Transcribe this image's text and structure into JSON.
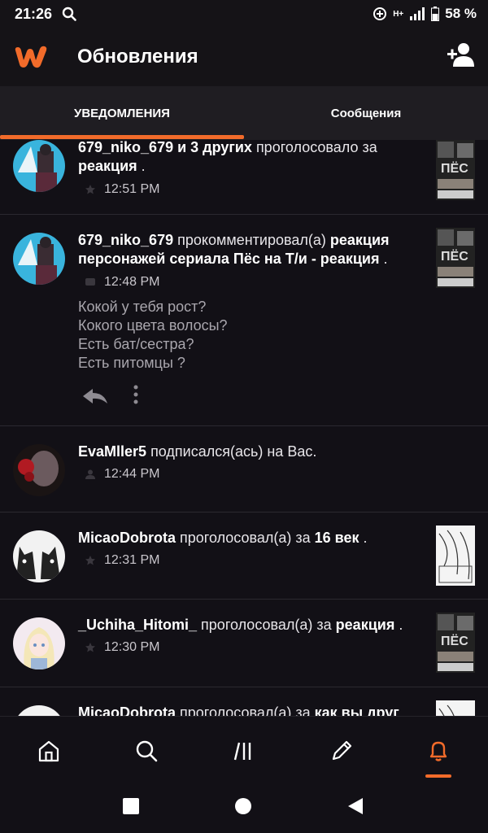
{
  "status_bar": {
    "time": "21:26",
    "network": "H+",
    "battery": "58 %"
  },
  "header": {
    "title": "Обновления"
  },
  "tabs": [
    {
      "label": "УВЕДОМЛЕНИЯ",
      "active": true
    },
    {
      "label": "Сообщения",
      "active": false
    }
  ],
  "notifications": [
    {
      "user": "679_niko_679 и 3 других",
      "action": " проголосовало за ",
      "target": "реакция",
      "suffix": " .",
      "time": "12:51 PM",
      "icon": "star-icon"
    },
    {
      "user": "679_niko_679",
      "action": " прокомментировал(а) ",
      "target": "реакция персонажей сериала Пёс на Т/и - реакция",
      "suffix": " .",
      "time": "12:48 PM",
      "icon": "comment-icon",
      "comment": [
        "Кокой у тебя рост?",
        "Кокого цвета волосы?",
        "Есть бат/сестра?",
        "Есть питомцы ?"
      ]
    },
    {
      "user": "EvaMller5",
      "action": " подписался(ась) на Вас.",
      "target": "",
      "suffix": "",
      "time": "12:44 PM",
      "icon": "follow-icon"
    },
    {
      "user": "MicaoDobrota",
      "action": " проголосовал(а) за ",
      "target": "16 век",
      "suffix": " .",
      "time": "12:31 PM",
      "icon": "star-icon"
    },
    {
      "user": "_Uchiha_Hitomi_",
      "action": " проголосовал(а) за ",
      "target": "реакция",
      "suffix": " .",
      "time": "12:30 PM",
      "icon": "star-icon"
    },
    {
      "user": "MicaoDobrota",
      "action": " проголосовал(а) за ",
      "target": "как вы друг",
      "suffix": "",
      "time": "",
      "icon": "star-icon"
    }
  ],
  "bottom_nav": [
    "home-icon",
    "search-icon",
    "library-icon",
    "write-icon",
    "notifications-icon"
  ],
  "colors": {
    "accent": "#f26b2a",
    "background": "#121016",
    "tabs_bg": "#1f1d22"
  }
}
